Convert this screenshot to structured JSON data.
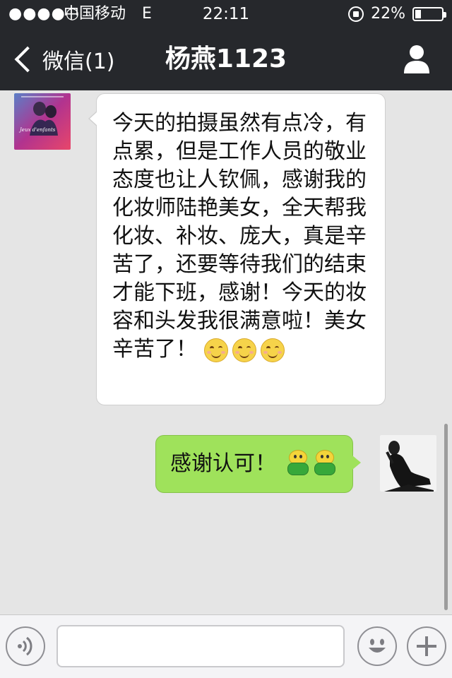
{
  "status_bar": {
    "signal": "●●●●○",
    "carrier": "中国移动",
    "network": "E",
    "time": "22:11",
    "battery": "22%",
    "battery_level": 0.22
  },
  "nav": {
    "back_label": "微信(1)",
    "title": "杨燕1123"
  },
  "messages": [
    {
      "direction": "incoming",
      "text": "今天的拍摄虽然有点冷，有点累，但是工作人员的敬业态度也让人钦佩，感谢我的化妆师陆艳美女，全天帮我化妆、补妆、庞大，真是辛苦了，还要等待我们的结束才能下班，感谢！今天的妆容和头发我很满意啦！美女辛苦了！",
      "emoji": [
        "smile-emoji",
        "smile-emoji",
        "smile-emoji"
      ],
      "avatar_caption": "Jeux d'enfants"
    },
    {
      "direction": "outgoing",
      "text": "感谢认可！",
      "emoji": [
        "frog-emoji",
        "frog-emoji"
      ]
    }
  ],
  "input": {
    "placeholder": "",
    "value": ""
  },
  "colors": {
    "nav_bg": "#26282c",
    "chat_bg": "#e5e5e5",
    "outgoing_bubble": "#9fe25b",
    "incoming_bubble": "#ffffff"
  }
}
